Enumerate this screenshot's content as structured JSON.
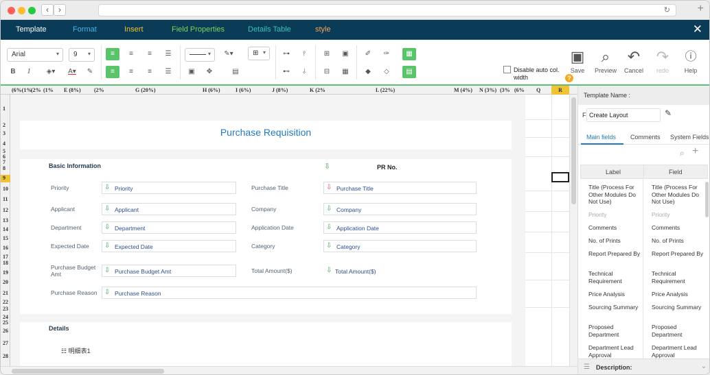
{
  "menu": {
    "items": [
      "Template",
      "Format",
      "Insert",
      "Field Properties",
      "Details Table",
      "style"
    ]
  },
  "toolbar": {
    "font": "Arial",
    "size": "9",
    "disable_auto_col": "Disable auto col. width",
    "save": "Save",
    "preview": "Preview",
    "cancel": "Cancel",
    "redo": "redo",
    "help": "Help",
    "disable_help": "?"
  },
  "columns": [
    "(6%(1%",
    "(2%",
    "(1%",
    "E (8%)",
    "(2%",
    "G (20%)",
    "H (6%)",
    "I (6%)",
    "J (8%)",
    "K (2%",
    "L (22%)",
    "M (4%)",
    "N (3%)",
    "(3%",
    "(6%",
    "Q",
    "R"
  ],
  "rows": [
    "1",
    "2",
    "3",
    "4",
    "5",
    "6",
    "7",
    "8",
    "9",
    "10",
    "11",
    "12",
    "13",
    "14",
    "15",
    "16",
    "17",
    "18",
    "19",
    "20",
    "21",
    "22",
    "23",
    "24",
    "25",
    "26",
    "27",
    "28"
  ],
  "form": {
    "title": "Purchase Requisition",
    "basic": "Basic Information",
    "pr_no": "PR No.",
    "labels_left": [
      "Priority",
      "Applicant",
      "Department",
      "Expected Date",
      "Purchase Budget Amt",
      "Purchase Reason"
    ],
    "fields_left": [
      "Priority",
      "Applicant",
      "Department",
      "Expected Date",
      "Purchase Budget Amt",
      "Purchase Reason"
    ],
    "labels_right": [
      "Purchase Title",
      "Company",
      "Application Date",
      "Category",
      "Total Amount($)"
    ],
    "fields_right": [
      "Purchase Title",
      "Company",
      "Application Date",
      "Category",
      "Total Amount($)"
    ],
    "details": "Details",
    "details_item": "明细表1"
  },
  "panel": {
    "template_name_label": "Template Name :",
    "layout_prefix": "F",
    "layout_value": "Create Layout",
    "tabs": [
      "Main fields",
      "Comments",
      "System Fields"
    ],
    "col_label": "Label",
    "col_field": "Field",
    "rows": [
      {
        "label": "Title (Process For Other Modules Do Not Use)",
        "field": "Title (Process For Other Modules Do Not Use)"
      },
      {
        "label": "Priority",
        "field": "Priority"
      },
      {
        "label": "Comments",
        "field": "Comments"
      },
      {
        "label": "No. of Prints",
        "field": "No. of Prints"
      },
      {
        "label": "Report Prepared By",
        "field": "Report Prepared By"
      },
      {
        "label": "Technical Requirement",
        "field": "Technical Requirement"
      },
      {
        "label": "Price Analysis",
        "field": "Price Analysis"
      },
      {
        "label": "Sourcing Summary",
        "field": "Sourcing Summary"
      },
      {
        "label": "Proposed Department",
        "field": "Proposed Department"
      },
      {
        "label": "Department Lead Approval",
        "field": "Department Lead Approval"
      }
    ],
    "description": "Description:"
  },
  "colors": {
    "menubar": "#0a3b57",
    "accent": "#1f7bbf",
    "green": "#5bc46b"
  }
}
